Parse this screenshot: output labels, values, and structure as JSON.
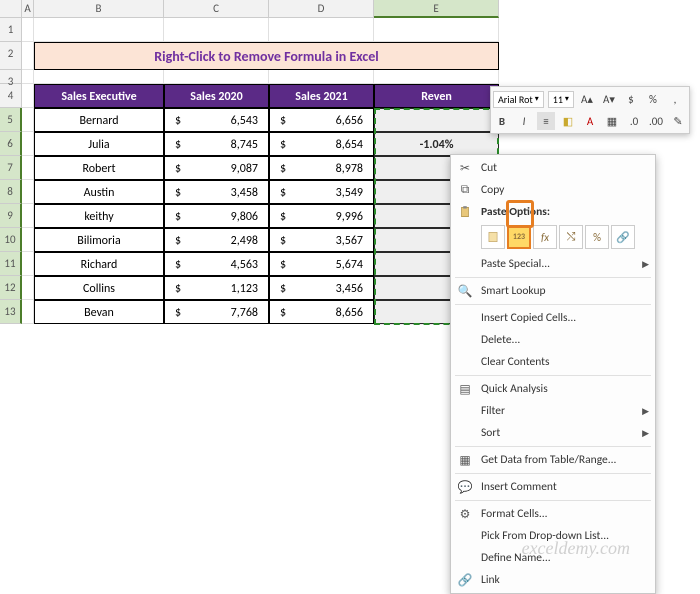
{
  "title": "Right-Click to Remove Formula in Excel",
  "columns": [
    "",
    "A",
    "B",
    "C",
    "D",
    "E"
  ],
  "headers": {
    "b": "Sales Executive",
    "c": "Sales 2020",
    "d": "Sales 2021",
    "e": "Reven"
  },
  "rows": [
    {
      "name": "Bernard",
      "s20": "6,543",
      "s21": "6,656"
    },
    {
      "name": "Julia",
      "s20": "8,745",
      "s21": "8,654"
    },
    {
      "name": "Robert",
      "s20": "9,087",
      "s21": "8,978"
    },
    {
      "name": "Austin",
      "s20": "3,458",
      "s21": "3,549"
    },
    {
      "name": "keithy",
      "s20": "9,806",
      "s21": "9,996"
    },
    {
      "name": "Bilimoria",
      "s20": "2,498",
      "s21": "3,567"
    },
    {
      "name": "Richard",
      "s20": "4,563",
      "s21": "5,674"
    },
    {
      "name": "Collins",
      "s20": "1,123",
      "s21": "3,456"
    },
    {
      "name": "Bevan",
      "s20": "7,768",
      "s21": "8,656"
    }
  ],
  "visibleValue": "-1.04%",
  "currency": "$",
  "miniToolbar": {
    "font": "Arial Rot",
    "size": "11",
    "buttons": {
      "bold": "B",
      "italic": "I"
    }
  },
  "contextMenu": {
    "cut": "Cut",
    "copy": "Copy",
    "pasteOptionsHdr": "Paste Options:",
    "pasteSpecial": "Paste Special...",
    "smartLookup": "Smart Lookup",
    "insertCopied": "Insert Copied Cells...",
    "delete": "Delete...",
    "clearContents": "Clear Contents",
    "quickAnalysis": "Quick Analysis",
    "filter": "Filter",
    "sort": "Sort",
    "getData": "Get Data from Table/Range...",
    "insertComment": "Insert Comment",
    "formatCells": "Format Cells...",
    "pickDropdown": "Pick From Drop-down List...",
    "defineName": "Define Name...",
    "link": "Link",
    "pasteValuesLabel": "123"
  },
  "watermark": "exceldemy.com",
  "colWidths": {
    "corner": 22,
    "A": 12,
    "B": 130,
    "C": 105,
    "D": 105,
    "E": 125
  }
}
